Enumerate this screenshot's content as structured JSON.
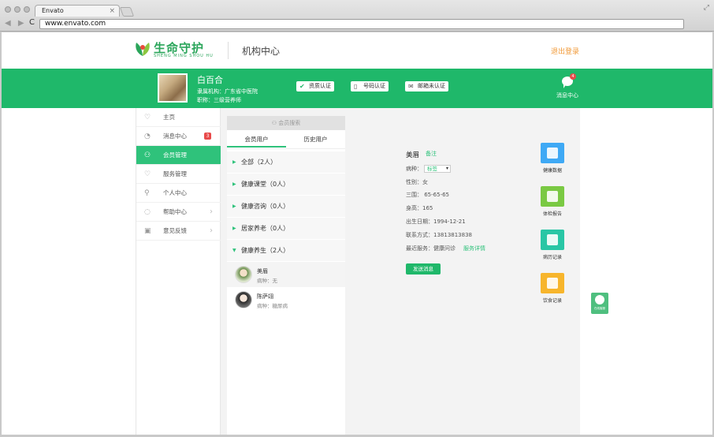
{
  "browser": {
    "tab_title": "Envato",
    "tab_close": "×",
    "address": "www.envato.com",
    "nav_arrows": "◀ ▶",
    "reload": "C",
    "resize_icon": "⤢"
  },
  "header": {
    "logo_cn": "生命守护",
    "logo_pinyin": "SHENG MING SHOU HU",
    "institution": "机构中心",
    "logout": "退出登录"
  },
  "user": {
    "name": "白百合",
    "org": "隶属机构：广东省中医院",
    "title": "职称：三级营养师",
    "cert_buttons": [
      {
        "label": "资质认证",
        "icon": "✔"
      },
      {
        "label": "号码认证",
        "icon": "▯"
      },
      {
        "label": "邮箱未认证",
        "icon": "✉"
      }
    ],
    "message_center": "消息中心",
    "message_badge": "4"
  },
  "sidebar": {
    "items": [
      {
        "label": "主页",
        "icon": "♡"
      },
      {
        "label": "消息中心",
        "icon": "◔",
        "badge": "3"
      },
      {
        "label": "会员管理",
        "icon": "⚇"
      },
      {
        "label": "服务管理",
        "icon": "♡"
      },
      {
        "label": "个人中心",
        "icon": "⚲"
      },
      {
        "label": "帮助中心",
        "icon": "◌",
        "chevron": "›"
      },
      {
        "label": "意见反馈",
        "icon": "▣",
        "chevron": "›"
      }
    ]
  },
  "members": {
    "search_placeholder": "会员搜索",
    "add": "+",
    "tabs": [
      "会员用户",
      "历史用户"
    ],
    "groups": [
      {
        "label": "全部（2人）",
        "arrow": "▶"
      },
      {
        "label": "健康课堂（0人）",
        "arrow": "▶"
      },
      {
        "label": "健康咨询（0人）",
        "arrow": "▶"
      },
      {
        "label": "居家养老（0人）",
        "arrow": "▶"
      },
      {
        "label": "健康养生（2人）",
        "arrow": "▼"
      }
    ],
    "list": [
      {
        "name": "美眉",
        "disease": "病种：无"
      },
      {
        "name": "陈萨翊",
        "disease": "病种：糖尿病"
      }
    ]
  },
  "detail": {
    "name": "美眉",
    "note": "备注",
    "disease_label": "病种：",
    "disease_select": "标签",
    "gender": "性别：女",
    "measurements": "三围：  65-65-65",
    "height": "身高：165",
    "birth": "出生日期：1994-12-21",
    "contact": "联系方式：13813813838",
    "recent_service": "最近服务：健康问诊",
    "service_detail": "服务详情",
    "send_message": "发送消息",
    "tiles": [
      {
        "label": "健康数据",
        "color": "#3fa9f5"
      },
      {
        "label": "体检报告",
        "color": "#7ac943"
      },
      {
        "label": "病历记录",
        "color": "#29c6a5"
      },
      {
        "label": "饮食记录",
        "color": "#f7b52c"
      }
    ]
  },
  "float_widget": {
    "label": "在线客服"
  },
  "colors": {
    "brand_green": "#1fb86a",
    "active_green": "#2fc27b",
    "logout_orange": "#f19a38",
    "badge_red": "#e84a4a"
  }
}
